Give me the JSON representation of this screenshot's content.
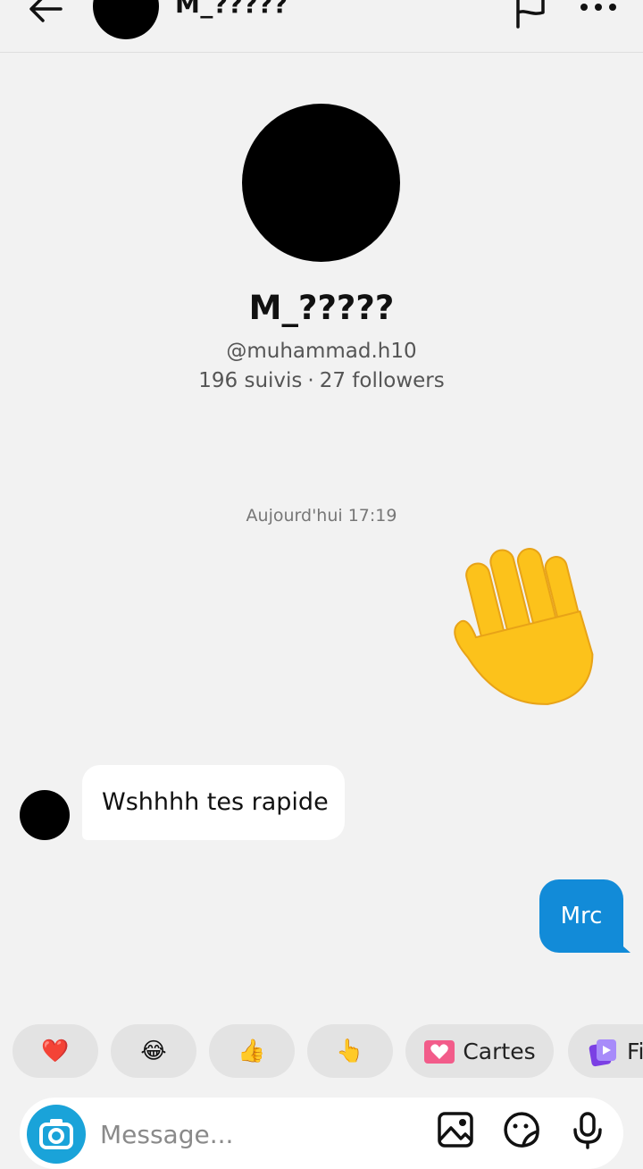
{
  "header": {
    "name": "M_?????",
    "back_icon": "arrow-left-icon",
    "flag_icon": "flag-icon",
    "more_icon": "more-horizontal-icon"
  },
  "profile": {
    "name": "M_?????",
    "handle": "@muhammad.h10",
    "following": "196 suivis",
    "separator": "·",
    "followers": "27 followers"
  },
  "messages": {
    "timestamp": "Aujourd'hui 17:19",
    "wave_icon": "waving-hand-icon",
    "incoming_text": "Wshhhh tes rapide",
    "outgoing_text": "Mrc"
  },
  "quick_replies": {
    "items": [
      {
        "emoji": "❤️",
        "icon": "heart-icon"
      },
      {
        "emoji": "😂",
        "icon": "tears-of-joy-icon"
      },
      {
        "emoji": "👍",
        "icon": "thumbs-up-icon"
      },
      {
        "emoji": "👆",
        "icon": "point-up-icon"
      }
    ],
    "cards_label": "Cartes",
    "cards_icon": "heart-card-icon",
    "partial_label": "Fi",
    "partial_icon": "video-cards-icon"
  },
  "composer": {
    "placeholder": "Message...",
    "camera_icon": "camera-icon",
    "image_icon": "image-icon",
    "sticker_icon": "sticker-icon",
    "mic_icon": "microphone-icon"
  },
  "colors": {
    "background": "#f2f2f2",
    "outgoing_bubble": "#128bd8",
    "camera_button": "#1aa3d9"
  }
}
